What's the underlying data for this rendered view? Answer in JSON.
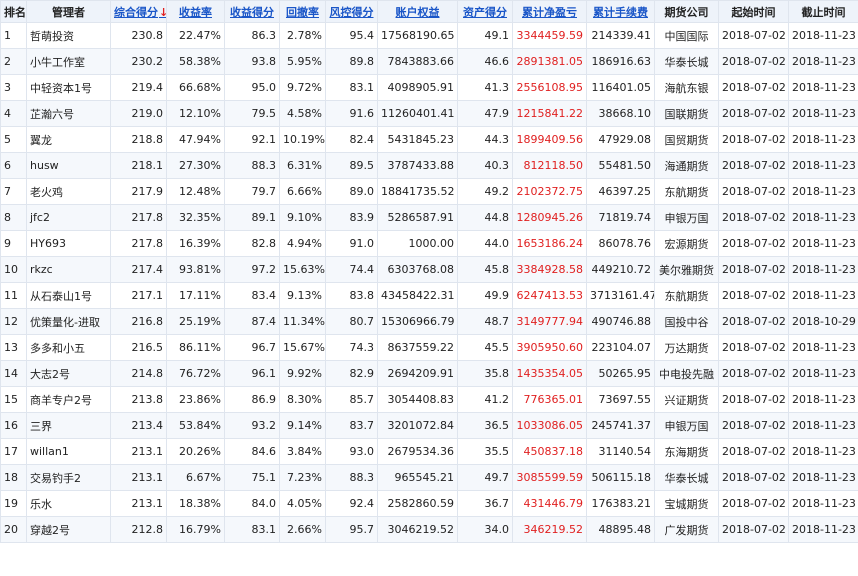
{
  "table": {
    "headers": {
      "rank": "排名",
      "manager": "管理者",
      "score": "综合得分",
      "return_rate": "收益率",
      "return_score": "收益得分",
      "drawdown": "回撤率",
      "risk_score": "风控得分",
      "equity": "账户权益",
      "asset_score": "资产得分",
      "net_profit": "累计净盈亏",
      "fees": "累计手续费",
      "broker": "期货公司",
      "start": "起始时间",
      "end": "截止时间"
    },
    "sort_arrow": "↓",
    "rows": [
      {
        "rank": "1",
        "manager": "哲萌投资",
        "score": "230.8",
        "return_rate": "22.47%",
        "return_score": "86.3",
        "drawdown": "2.78%",
        "risk_score": "95.4",
        "equity": "17568190.65",
        "asset_score": "49.1",
        "net_profit": "3344459.59",
        "fees": "214339.41",
        "broker": "中国国际",
        "start": "2018-07-02",
        "end": "2018-11-23"
      },
      {
        "rank": "2",
        "manager": "小牛工作室",
        "score": "230.2",
        "return_rate": "58.38%",
        "return_score": "93.8",
        "drawdown": "5.95%",
        "risk_score": "89.8",
        "equity": "7843883.66",
        "asset_score": "46.6",
        "net_profit": "2891381.05",
        "fees": "186916.63",
        "broker": "华泰长城",
        "start": "2018-07-02",
        "end": "2018-11-23"
      },
      {
        "rank": "3",
        "manager": "中轻资本1号",
        "score": "219.4",
        "return_rate": "66.68%",
        "return_score": "95.0",
        "drawdown": "9.72%",
        "risk_score": "83.1",
        "equity": "4098905.91",
        "asset_score": "41.3",
        "net_profit": "2556108.95",
        "fees": "116401.05",
        "broker": "海航东银",
        "start": "2018-07-02",
        "end": "2018-11-23"
      },
      {
        "rank": "4",
        "manager": "芷瀚六号",
        "score": "219.0",
        "return_rate": "12.10%",
        "return_score": "79.5",
        "drawdown": "4.58%",
        "risk_score": "91.6",
        "equity": "11260401.41",
        "asset_score": "47.9",
        "net_profit": "1215841.22",
        "fees": "38668.10",
        "broker": "国联期货",
        "start": "2018-07-02",
        "end": "2018-11-23"
      },
      {
        "rank": "5",
        "manager": "翼龙",
        "score": "218.8",
        "return_rate": "47.94%",
        "return_score": "92.1",
        "drawdown": "10.19%",
        "risk_score": "82.4",
        "equity": "5431845.23",
        "asset_score": "44.3",
        "net_profit": "1899409.56",
        "fees": "47929.08",
        "broker": "国贸期货",
        "start": "2018-07-02",
        "end": "2018-11-23"
      },
      {
        "rank": "6",
        "manager": "husw",
        "score": "218.1",
        "return_rate": "27.30%",
        "return_score": "88.3",
        "drawdown": "6.31%",
        "risk_score": "89.5",
        "equity": "3787433.88",
        "asset_score": "40.3",
        "net_profit": "812118.50",
        "fees": "55481.50",
        "broker": "海通期货",
        "start": "2018-07-02",
        "end": "2018-11-23"
      },
      {
        "rank": "7",
        "manager": "老火鸡",
        "score": "217.9",
        "return_rate": "12.48%",
        "return_score": "79.7",
        "drawdown": "6.66%",
        "risk_score": "89.0",
        "equity": "18841735.52",
        "asset_score": "49.2",
        "net_profit": "2102372.75",
        "fees": "46397.25",
        "broker": "东航期货",
        "start": "2018-07-02",
        "end": "2018-11-23"
      },
      {
        "rank": "8",
        "manager": "jfc2",
        "score": "217.8",
        "return_rate": "32.35%",
        "return_score": "89.1",
        "drawdown": "9.10%",
        "risk_score": "83.9",
        "equity": "5286587.91",
        "asset_score": "44.8",
        "net_profit": "1280945.26",
        "fees": "71819.74",
        "broker": "申银万国",
        "start": "2018-07-02",
        "end": "2018-11-23"
      },
      {
        "rank": "9",
        "manager": "HY693",
        "score": "217.8",
        "return_rate": "16.39%",
        "return_score": "82.8",
        "drawdown": "4.94%",
        "risk_score": "91.0",
        "equity": "1000.00",
        "asset_score": "44.0",
        "net_profit": "1653186.24",
        "fees": "86078.76",
        "broker": "宏源期货",
        "start": "2018-07-02",
        "end": "2018-11-23"
      },
      {
        "rank": "10",
        "manager": "rkzc",
        "score": "217.4",
        "return_rate": "93.81%",
        "return_score": "97.2",
        "drawdown": "15.63%",
        "risk_score": "74.4",
        "equity": "6303768.08",
        "asset_score": "45.8",
        "net_profit": "3384928.58",
        "fees": "449210.72",
        "broker": "美尔雅期货",
        "start": "2018-07-02",
        "end": "2018-11-23"
      },
      {
        "rank": "11",
        "manager": "从石泰山1号",
        "score": "217.1",
        "return_rate": "17.11%",
        "return_score": "83.4",
        "drawdown": "9.13%",
        "risk_score": "83.8",
        "equity": "43458422.31",
        "asset_score": "49.9",
        "net_profit": "6247413.53",
        "fees": "3713161.47",
        "broker": "东航期货",
        "start": "2018-07-02",
        "end": "2018-11-23"
      },
      {
        "rank": "12",
        "manager": "优策量化-进取",
        "score": "216.8",
        "return_rate": "25.19%",
        "return_score": "87.4",
        "drawdown": "11.34%",
        "risk_score": "80.7",
        "equity": "15306966.79",
        "asset_score": "48.7",
        "net_profit": "3149777.94",
        "fees": "490746.88",
        "broker": "国投中谷",
        "start": "2018-07-02",
        "end": "2018-10-29"
      },
      {
        "rank": "13",
        "manager": "多多和小五",
        "score": "216.5",
        "return_rate": "86.11%",
        "return_score": "96.7",
        "drawdown": "15.67%",
        "risk_score": "74.3",
        "equity": "8637559.22",
        "asset_score": "45.5",
        "net_profit": "3905950.60",
        "fees": "223104.07",
        "broker": "万达期货",
        "start": "2018-07-02",
        "end": "2018-11-23"
      },
      {
        "rank": "14",
        "manager": "大志2号",
        "score": "214.8",
        "return_rate": "76.72%",
        "return_score": "96.1",
        "drawdown": "9.92%",
        "risk_score": "82.9",
        "equity": "2694209.91",
        "asset_score": "35.8",
        "net_profit": "1435354.05",
        "fees": "50265.95",
        "broker": "中电投先融",
        "start": "2018-07-02",
        "end": "2018-11-23"
      },
      {
        "rank": "15",
        "manager": "商羊专户2号",
        "score": "213.8",
        "return_rate": "23.86%",
        "return_score": "86.9",
        "drawdown": "8.30%",
        "risk_score": "85.7",
        "equity": "3054408.83",
        "asset_score": "41.2",
        "net_profit": "776365.01",
        "fees": "73697.55",
        "broker": "兴证期货",
        "start": "2018-07-02",
        "end": "2018-11-23"
      },
      {
        "rank": "16",
        "manager": "三界",
        "score": "213.4",
        "return_rate": "53.84%",
        "return_score": "93.2",
        "drawdown": "9.14%",
        "risk_score": "83.7",
        "equity": "3201072.84",
        "asset_score": "36.5",
        "net_profit": "1033086.05",
        "fees": "245741.37",
        "broker": "申银万国",
        "start": "2018-07-02",
        "end": "2018-11-23"
      },
      {
        "rank": "17",
        "manager": "willan1",
        "score": "213.1",
        "return_rate": "20.26%",
        "return_score": "84.6",
        "drawdown": "3.84%",
        "risk_score": "93.0",
        "equity": "2679534.36",
        "asset_score": "35.5",
        "net_profit": "450837.18",
        "fees": "31140.54",
        "broker": "东海期货",
        "start": "2018-07-02",
        "end": "2018-11-23"
      },
      {
        "rank": "18",
        "manager": "交易钓手2",
        "score": "213.1",
        "return_rate": "6.67%",
        "return_score": "75.1",
        "drawdown": "7.23%",
        "risk_score": "88.3",
        "equity": "965545.21",
        "asset_score": "49.7",
        "net_profit": "3085599.59",
        "fees": "506115.18",
        "broker": "华泰长城",
        "start": "2018-07-02",
        "end": "2018-11-23"
      },
      {
        "rank": "19",
        "manager": "乐水",
        "score": "213.1",
        "return_rate": "18.38%",
        "return_score": "84.0",
        "drawdown": "4.05%",
        "risk_score": "92.4",
        "equity": "2582860.59",
        "asset_score": "36.7",
        "net_profit": "431446.79",
        "fees": "176383.21",
        "broker": "宝城期货",
        "start": "2018-07-02",
        "end": "2018-11-23"
      },
      {
        "rank": "20",
        "manager": "穿越2号",
        "score": "212.8",
        "return_rate": "16.79%",
        "return_score": "83.1",
        "drawdown": "2.66%",
        "risk_score": "95.7",
        "equity": "3046219.52",
        "asset_score": "34.0",
        "net_profit": "346219.52",
        "fees": "48895.48",
        "broker": "广发期货",
        "start": "2018-07-02",
        "end": "2018-11-23"
      }
    ]
  }
}
